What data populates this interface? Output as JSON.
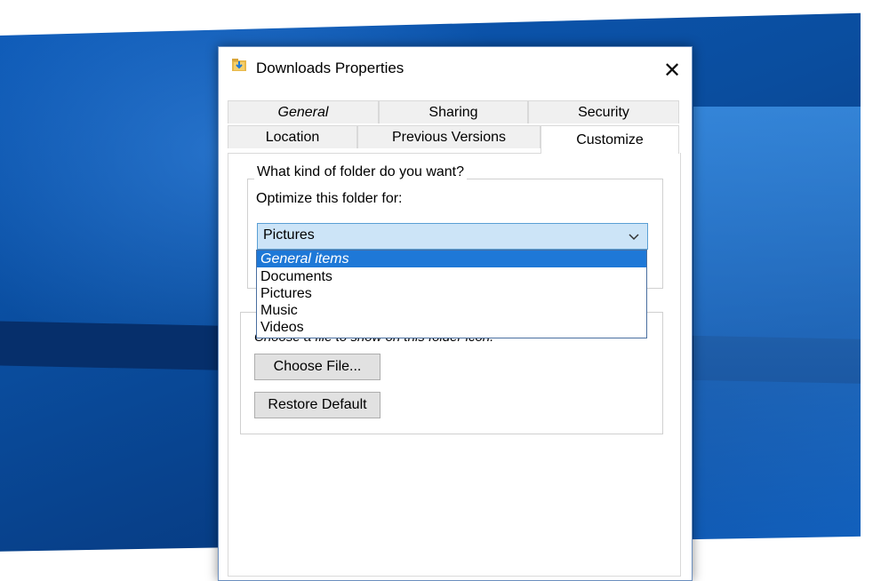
{
  "window": {
    "title": "Downloads Properties",
    "close_symbol": "✕",
    "icon": "folder-download-icon"
  },
  "tabs": {
    "row1": [
      "General",
      "Sharing",
      "Security"
    ],
    "row2": [
      "Location",
      "Previous Versions",
      "Customize"
    ],
    "active": "Customize"
  },
  "customize": {
    "folder_group_label": "What kind of folder do you want?",
    "optimize_label": "Optimize this folder for:",
    "selected_value": "Pictures",
    "options": [
      "General items",
      "Documents",
      "Pictures",
      "Music",
      "Videos"
    ],
    "highlighted_option": "General items",
    "choose_file_label": "Choose a file to show on this folder icon.",
    "choose_file_button": "Choose File...",
    "restore_default_button": "Restore Default"
  },
  "colors": {
    "desktop_blue": "#0a4d9e",
    "selection_blue": "#1e78d7",
    "combo_highlight": "#cce4f7"
  }
}
